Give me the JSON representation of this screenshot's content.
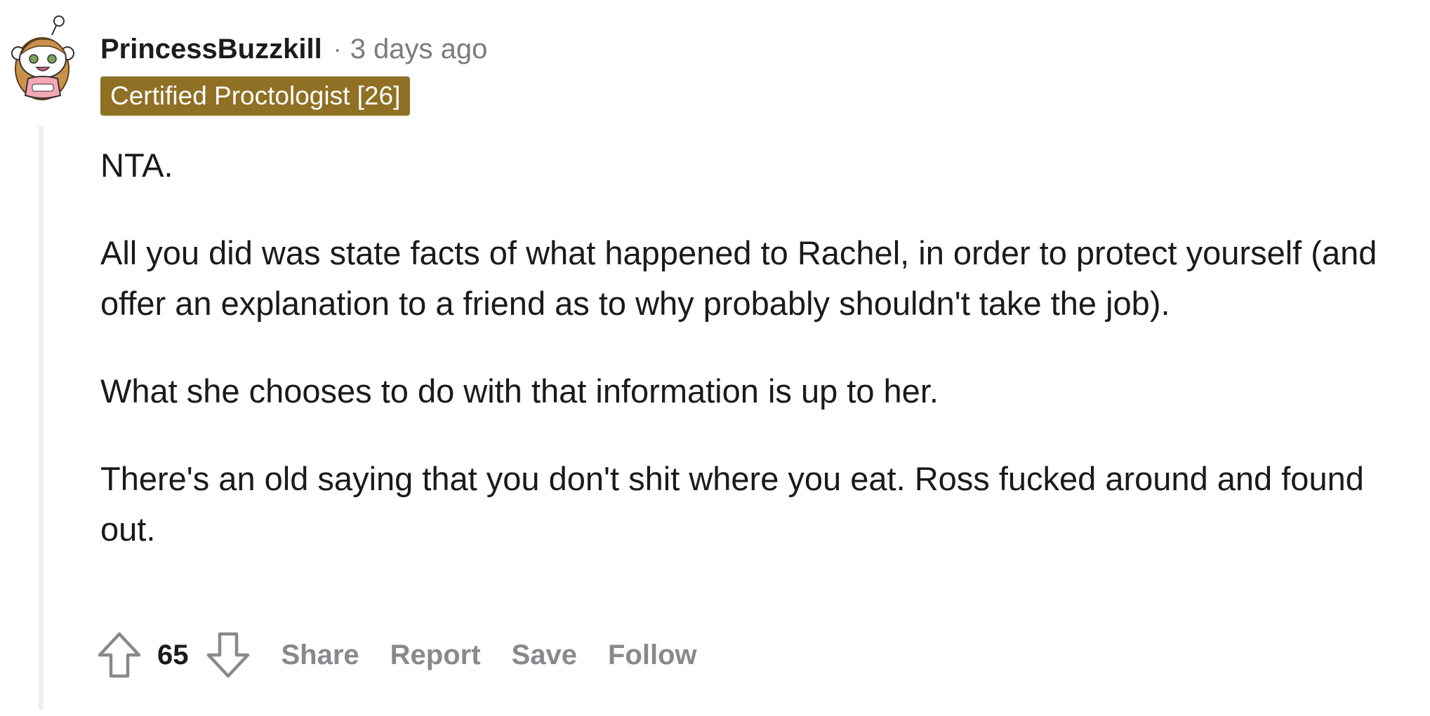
{
  "comment": {
    "username": "PrincessBuzzkill",
    "separator": "·",
    "timestamp": "3 days ago",
    "flair": "Certified Proctologist [26]",
    "paragraphs": [
      "NTA.",
      "All you did was state facts of what happened to Rachel, in order to protect yourself (and offer an explanation to a friend as to why probably shouldn't take the job).",
      "What she chooses to do with that information is up to her.",
      "There's an old saying that you don't shit where you eat. Ross fucked around and found out."
    ],
    "score": "65",
    "actions": {
      "share": "Share",
      "report": "Report",
      "save": "Save",
      "follow": "Follow"
    }
  },
  "colors": {
    "flair_bg": "#8f7024",
    "action_text": "#878a8c",
    "thread_line": "#edeff1"
  },
  "icons": {
    "avatar": "snoo-avatar-icon",
    "upvote": "upvote-arrow-icon",
    "downvote": "downvote-arrow-icon"
  }
}
